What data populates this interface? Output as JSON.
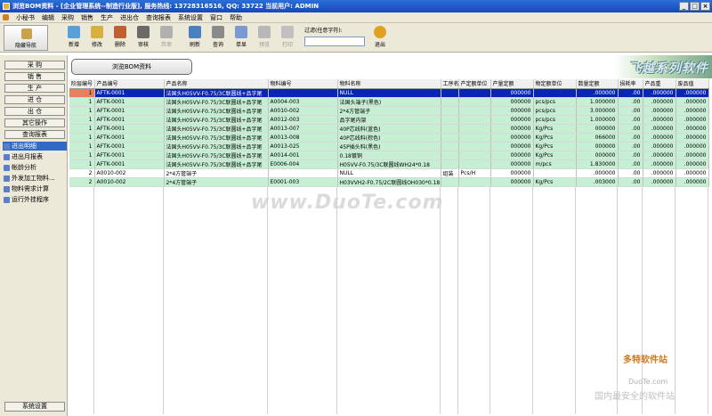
{
  "window": {
    "title": "浏览BOM资料 - [企业管理系统--制造行业版], 服务热线: 13728316516, QQ: 33722 当前用户: ADMIN"
  },
  "menu": [
    "小秘书",
    "编辑",
    "采购",
    "销售",
    "生产",
    "进出仓",
    "查询报表",
    "系统设置",
    "窗口",
    "帮助"
  ],
  "toolbar": {
    "nav_toggle": "隐藏导航",
    "buttons": [
      {
        "label": "新增",
        "icon": "new-icon"
      },
      {
        "label": "修改",
        "icon": "edit-icon"
      },
      {
        "label": "删除",
        "icon": "delete-icon"
      },
      {
        "label": "审核",
        "icon": "approve-icon"
      },
      {
        "label": "弃审",
        "icon": "unapprove-icon",
        "disabled": true
      },
      {
        "label": "刷新",
        "icon": "refresh-icon"
      },
      {
        "label": "查询",
        "icon": "query-icon"
      },
      {
        "label": "单显",
        "icon": "single-view-icon"
      },
      {
        "label": "预览",
        "icon": "preview-icon",
        "disabled": true
      },
      {
        "label": "打印",
        "icon": "print-icon",
        "disabled": true
      },
      {
        "label": "退出",
        "icon": "exit-icon"
      }
    ],
    "filter_label": "过滤(任意字符):",
    "filter_value": ""
  },
  "sidebar": {
    "categories": [
      "采 购",
      "销 售",
      "生 产",
      "进 仓",
      "出 仓",
      "其它操作",
      "查询报表"
    ],
    "items": [
      {
        "label": "进出明细",
        "selected": true
      },
      {
        "label": "进出月报表"
      },
      {
        "label": "帐龄分析"
      },
      {
        "label": "外发加工物料..."
      },
      {
        "label": "物料需求计算"
      },
      {
        "label": "运行外挂程序"
      }
    ],
    "system_button": "系统设置"
  },
  "panel": {
    "title": "浏览BOM资料",
    "brand": "飞越系列软件"
  },
  "table": {
    "columns": [
      "阶层编号",
      "产品编号",
      "产品名称",
      "物料编号",
      "物料名称",
      "工序名",
      "产定额单位",
      "产量定额",
      "物定额单位",
      "数量定额",
      "损耗率",
      "产品重",
      "废品值"
    ],
    "rows": [
      {
        "cells": [
          "1",
          "AFTK-0001",
          "法国头H05VV-F0.75/3C联圆线+品字尾",
          "",
          "NULL",
          "",
          "",
          "000000",
          "",
          ".000000",
          ".00",
          ".000000",
          ".000000"
        ],
        "style": "sel"
      },
      {
        "cells": [
          "1",
          "AFTK-0001",
          "法国头H05VV-F0.75/3C联圆线+品字尾",
          "A0004-003",
          "法国头端子(黑色)",
          "",
          "",
          "000000",
          "pcs/pcs",
          "1.000000",
          ".00",
          ".000000",
          ".000000"
        ],
        "style": "g"
      },
      {
        "cells": [
          "1",
          "AFTK-0001",
          "法国头H05VV-F0.75/3C联圆线+品字尾",
          "A0010-002",
          "2*4方管端子",
          "",
          "",
          "000000",
          "pcs/pcs",
          "3.000000",
          ".00",
          ".000000",
          ".000000"
        ],
        "style": "g"
      },
      {
        "cells": [
          "1",
          "AFTK-0001",
          "法国头H05VV-F0.75/3C联圆线+品字尾",
          "A0012-003",
          "品字尾内架",
          "",
          "",
          "000000",
          "pcs/pcs",
          "1.000000",
          ".00",
          ".000000",
          ".000000"
        ],
        "style": "g"
      },
      {
        "cells": [
          "1",
          "AFTK-0001",
          "法国头H05VV-F0.75/3C联圆线+品字尾",
          "A0013-007",
          "40P芯线料(蓝色)",
          "",
          "",
          "000000",
          "Kg/Pcs",
          "000000",
          ".00",
          ".000000",
          ".000000"
        ],
        "style": "g"
      },
      {
        "cells": [
          "1",
          "AFTK-0001",
          "法国头H05VV-F0.75/3C联圆线+品字尾",
          "A0013-008",
          "40P芯线料(棕色)",
          "",
          "",
          "000000",
          "Kg/Pcs",
          "066000",
          ".00",
          ".000000",
          ".000000"
        ],
        "style": "g"
      },
      {
        "cells": [
          "1",
          "AFTK-0001",
          "法国头H05VV-F0.75/3C联圆线+品字尾",
          "A0013-025",
          "45P插头料(黑色)",
          "",
          "",
          "000000",
          "Kg/Pcs",
          "000000",
          ".00",
          ".000000",
          ".000000"
        ],
        "style": "g"
      },
      {
        "cells": [
          "1",
          "AFTK-0001",
          "法国头H05VV-F0.75/3C联圆线+品字尾",
          "A0014-001",
          "0.18镀铜",
          "",
          "",
          "000000",
          "Kg/Pcs",
          "000000",
          ".00",
          ".000000",
          ".000000"
        ],
        "style": "g"
      },
      {
        "cells": [
          "1",
          "AFTK-0001",
          "法国头H05VV-F0.75/3C联圆线+品字尾",
          "E0006-004",
          "H05VV-F0.75/3C联圆线WH24*0.18",
          "",
          "",
          "000000",
          "m/pcs",
          "1.830000",
          ".00",
          ".000000",
          ".000000"
        ],
        "style": "g"
      },
      {
        "cells": [
          "2",
          "A0010-002",
          "2*4方管端子",
          "",
          "NULL",
          "组装",
          "Pcs/H",
          "000000",
          "",
          ".000000",
          ".00",
          ".000000",
          ".000000"
        ],
        "style": "w"
      },
      {
        "cells": [
          "2",
          "A0010-002",
          "2*4方管端子",
          "E0001-003",
          "H03VVH2-F0.75/2C联圆线OH030*0.18",
          "",
          "",
          "000000",
          "Kg/Pcs",
          ".003000",
          ".00",
          ".000000",
          ".000000"
        ],
        "style": "g"
      }
    ]
  },
  "watermarks": {
    "main": "www.DuoTe.com",
    "logo": "多特软件站",
    "logo_sub": "DuoTe.com",
    "tagline": "国内最安全的软件站"
  },
  "colors": {
    "title_bar": "#1648b8",
    "row_green": "#c6f0d4",
    "row_selected": "#0a24b4",
    "row_marker": "#e88060"
  }
}
